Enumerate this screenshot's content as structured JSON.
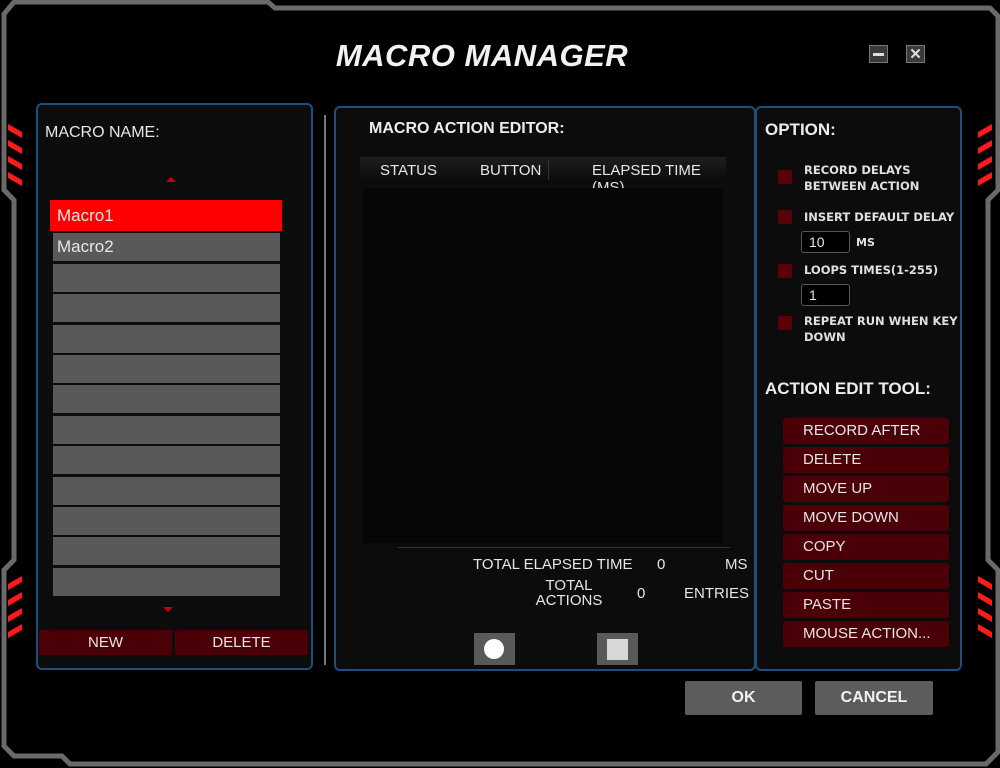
{
  "window": {
    "title": "MACRO MANAGER",
    "minimize_icon": "minimize-icon",
    "close_icon": "close-icon",
    "close_glyph": "✕"
  },
  "macro_panel": {
    "label": "MACRO NAME:",
    "scroll_up_icon": "triangle-up-icon",
    "scroll_down_icon": "triangle-down-icon",
    "items": [
      {
        "name": "Macro1",
        "selected": true
      },
      {
        "name": "Macro2",
        "selected": false
      },
      {
        "name": "",
        "selected": false
      },
      {
        "name": "",
        "selected": false
      },
      {
        "name": "",
        "selected": false
      },
      {
        "name": "",
        "selected": false
      },
      {
        "name": "",
        "selected": false
      },
      {
        "name": "",
        "selected": false
      },
      {
        "name": "",
        "selected": false
      },
      {
        "name": "",
        "selected": false
      },
      {
        "name": "",
        "selected": false
      },
      {
        "name": "",
        "selected": false
      },
      {
        "name": "",
        "selected": false
      }
    ],
    "new_label": "NEW",
    "delete_label": "DELETE"
  },
  "editor": {
    "title": "MACRO ACTION EDITOR:",
    "columns": [
      "STATUS",
      "BUTTON",
      "ELAPSED TIME (MS)"
    ],
    "rows": [],
    "total_elapsed_label": "TOTAL ELAPSED TIME",
    "total_elapsed_value": "0",
    "total_elapsed_unit": "MS",
    "total_actions_label": "TOTAL ACTIONS",
    "total_actions_value": "0",
    "total_actions_unit": "ENTRIES",
    "record_icon": "record-circle-icon",
    "stop_icon": "stop-square-icon"
  },
  "options": {
    "title": "OPTION:",
    "record_delays": {
      "label": "RECORD DELAYS BETWEEN ACTION",
      "checked": false
    },
    "insert_default_delay": {
      "label": "INSERT DEFAULT DELAY",
      "checked": false,
      "value": "10",
      "unit": "MS"
    },
    "loops_times": {
      "label": "LOOPS TIMES(1-255)",
      "checked": false,
      "value": "1"
    },
    "repeat_run": {
      "label": "REPEAT RUN WHEN KEY DOWN",
      "checked": false
    }
  },
  "action_tools": {
    "title": "ACTION EDIT TOOL:",
    "buttons": [
      "RECORD AFTER",
      "DELETE",
      "MOVE UP",
      "MOVE DOWN",
      "COPY",
      "CUT",
      "PASTE",
      "MOUSE ACTION..."
    ]
  },
  "footer": {
    "ok_label": "OK",
    "cancel_label": "CANCEL"
  },
  "colors": {
    "accent_red": "#ff0000",
    "dark_red_button": "#4a0006",
    "panel_border_blue": "#1d4f7a",
    "frame_gray": "#6a6a6a"
  }
}
